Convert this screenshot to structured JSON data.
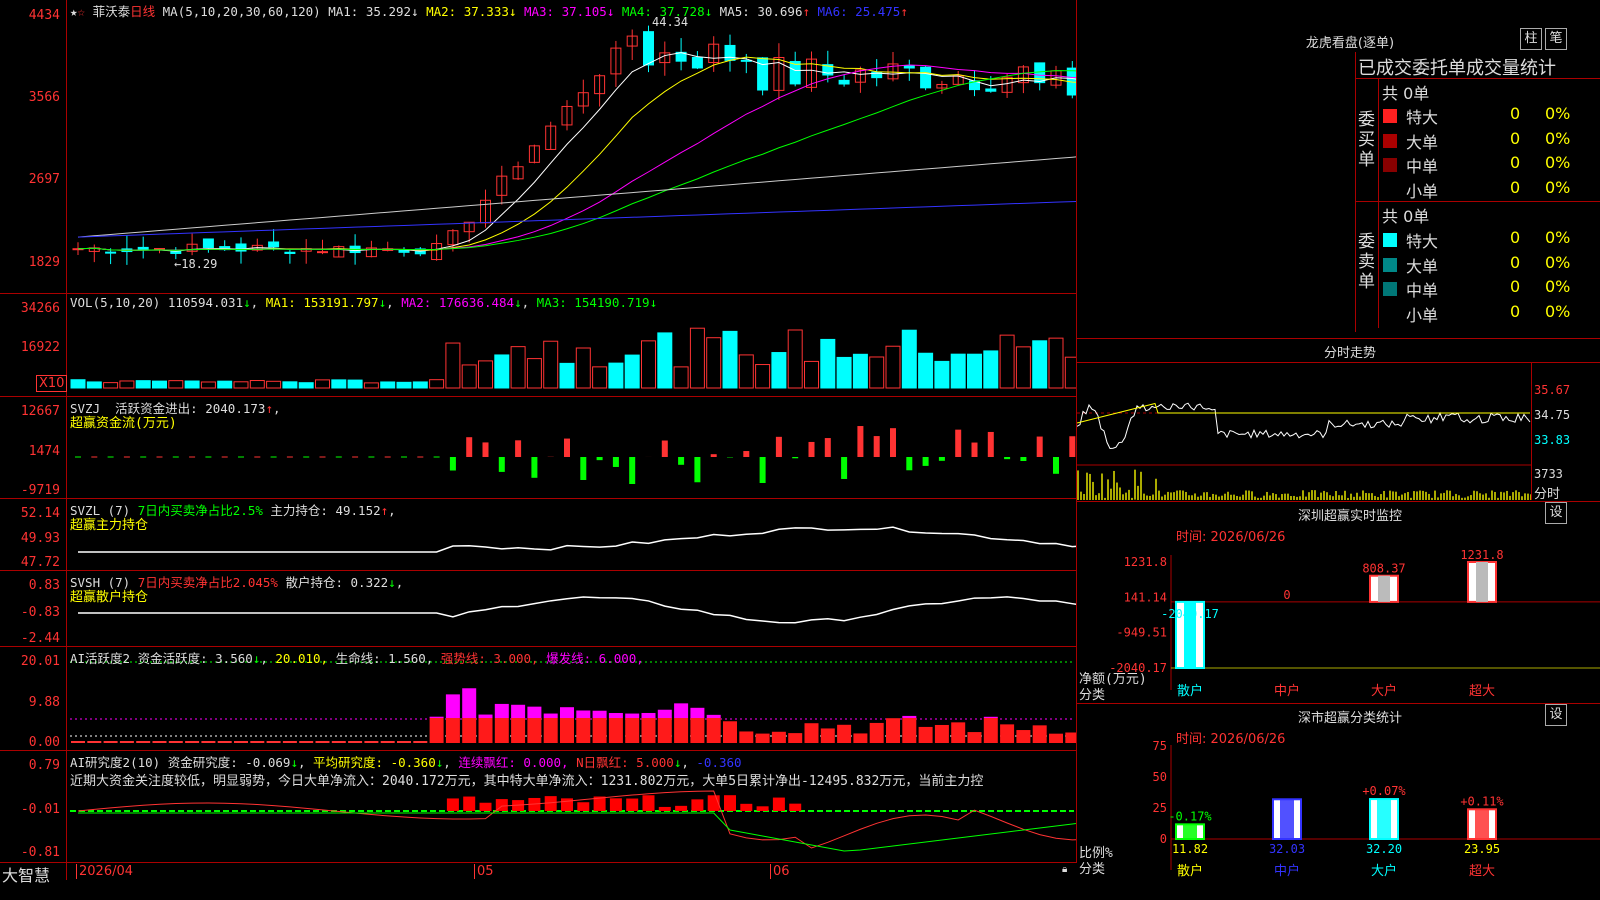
{
  "colors": {
    "up": "#ff3333",
    "down": "#00ffff",
    "grid": "#aa0000",
    "ma1": "#ffffff",
    "ma2": "#ffff00",
    "ma3": "#ff00ff",
    "ma4": "#00ff00",
    "ma5": "#cccccc",
    "ma6": "#3333ff"
  },
  "kline": {
    "title": "菲沃泰",
    "period": "日线",
    "ma_params": "MA(5,10,20,30,60,120)",
    "ma": [
      {
        "label": "MA1:",
        "value": "35.292",
        "arrow": "↓"
      },
      {
        "label": "MA2:",
        "value": "37.333",
        "arrow": "↓"
      },
      {
        "label": "MA3:",
        "value": "37.105",
        "arrow": "↓"
      },
      {
        "label": "MA4:",
        "value": "37.728",
        "arrow": "↓"
      },
      {
        "label": "MA5:",
        "value": "30.696",
        "arrow": "↑"
      },
      {
        "label": "MA6:",
        "value": "25.475",
        "arrow": "↑"
      }
    ],
    "yticks": [
      "4434",
      "3566",
      "2697",
      "1829"
    ],
    "high_label": "44.34",
    "low_label": "←18.29"
  },
  "vol": {
    "header": "VOL(5,10,20)",
    "value": "110594.031",
    "arrow": "↓",
    "ma1": "MA1: 153191.797",
    "ma2": "MA2: 176636.484",
    "ma3": "MA3: 154190.719",
    "yticks": [
      "34266",
      "16922"
    ],
    "unit": "X10"
  },
  "svzj": {
    "name": "SVZJ",
    "line1": "活跃资金进出: 2040.173",
    "sub": "超赢资金流(万元)",
    "yticks": [
      "12667",
      "1474",
      "-9719"
    ]
  },
  "svzl": {
    "name": "SVZL (7)",
    "note": "7日内买卖净占比2.5%",
    "main": "主力持仓: 49.152",
    "sub": "超赢主力持仓",
    "yticks": [
      "52.14",
      "49.93",
      "47.72"
    ]
  },
  "svsh": {
    "name": "SVSH (7)",
    "note": "7日内买卖净占比2.045%",
    "main": "散户持仓: 0.322",
    "sub": "超赢散户持仓",
    "yticks": [
      "0.83",
      "-0.83",
      "-2.44"
    ]
  },
  "ai1": {
    "name": "AI活跃度2",
    "a": "资金活跃度: 3.560",
    "b": "20.010,",
    "c": "生命线: 1.560,",
    "d": "强势线: 3.000,",
    "e": "爆发线: 6.000,",
    "yticks": [
      "20.01",
      "9.88",
      "0.00"
    ]
  },
  "ai2": {
    "name": "AI研究度2(10)",
    "a": "资金研究度: -0.069",
    "b": "平均研究度: -0.360",
    "c": "连续飘红: 0.000,",
    "d": "N日飘红: 5.000",
    "e": "-0.360",
    "note": "近期大资金关注度较低，明显弱势，今日大单净流入：2040.172万元，其中特大单净流入：1231.802万元，大单5日累计净出-12495.832万元，当前主力控",
    "yticks": [
      "0.79",
      "-0.01",
      "-0.81"
    ]
  },
  "xaxis": {
    "logo": "大智慧",
    "date": "2026/04",
    "m1": "05",
    "m2": "06"
  },
  "dragon": {
    "title": "龙虎看盘(逐单)",
    "btn1": "柱",
    "btn2": "笔",
    "tabs": "已成交委托单成交量统计",
    "buy": {
      "label": "委买单",
      "total": "共 0单",
      "rows": [
        {
          "name": "特大",
          "v": "0",
          "p": "0%"
        },
        {
          "name": "大单",
          "v": "0",
          "p": "0%"
        },
        {
          "name": "中单",
          "v": "0",
          "p": "0%"
        },
        {
          "name": "小单",
          "v": "0",
          "p": "0%"
        }
      ]
    },
    "sell": {
      "label": "委卖单",
      "total": "共 0单",
      "rows": [
        {
          "name": "特大",
          "v": "0",
          "p": "0%"
        },
        {
          "name": "大单",
          "v": "0",
          "p": "0%"
        },
        {
          "name": "中单",
          "v": "0",
          "p": "0%"
        },
        {
          "name": "小单",
          "v": "0",
          "p": "0%"
        }
      ]
    }
  },
  "intraday": {
    "title": "分时走势",
    "p1": "35.67",
    "p2": "34.75",
    "p3": "33.83",
    "v": "3733",
    "vlabel": "分时"
  },
  "monitor": {
    "title": "深圳超赢实时监控",
    "btn": "设",
    "time": "时间: 2026/06/26",
    "yticks": [
      "1231.8",
      "141.14",
      "-949.51",
      "-2040.17"
    ],
    "ylabel": "净额(万元)",
    "xlabel": "分类",
    "cats": [
      "散户",
      "中户",
      "大户",
      "超大"
    ],
    "values": [
      -2040.17,
      0,
      808.37,
      1231.8
    ],
    "labels": [
      "-2040.17",
      "0",
      "808.37",
      "1231.8"
    ]
  },
  "stats": {
    "title": "深市超赢分类统计",
    "btn": "设",
    "time": "时间: 2026/06/26",
    "yticks": [
      "75",
      "50",
      "25",
      "0"
    ],
    "ylabel": "比例%",
    "xlabel": "分类",
    "cats": [
      "散户",
      "中户",
      "大户",
      "超大"
    ],
    "values": [
      11.82,
      32.03,
      32.2,
      23.95
    ],
    "changes": [
      "-0.17%",
      "",
      "+0.07%",
      "+0.11%"
    ],
    "valtexts": [
      "11.82",
      "32.03",
      "32.20",
      "23.95"
    ]
  }
}
